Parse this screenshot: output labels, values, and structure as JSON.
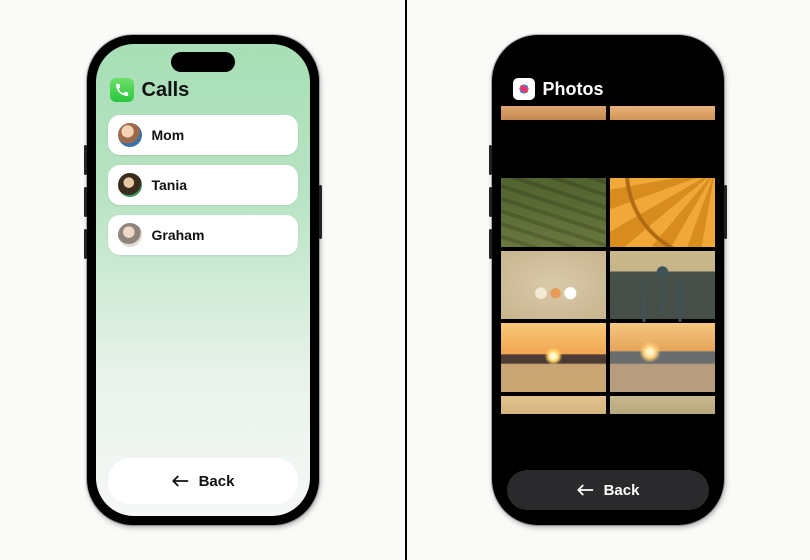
{
  "left": {
    "app_title": "Calls",
    "app_icon": "phone-icon",
    "contacts": [
      {
        "name": "Mom",
        "avatar": "av-mom"
      },
      {
        "name": "Tania",
        "avatar": "av-tania"
      },
      {
        "name": "Graham",
        "avatar": "av-graham"
      }
    ],
    "back_label": "Back"
  },
  "right": {
    "app_title": "Photos",
    "app_icon": "photos-icon",
    "back_label": "Back",
    "thumbnails": [
      "row-top-left",
      "row-top-right",
      "boardwalk-stairs",
      "orange-umbrella",
      "seashells-on-sand",
      "person-shadow-on-sand",
      "ocean-sunset-1",
      "ocean-sunset-2",
      "row-bottom-left",
      "row-bottom-right"
    ]
  }
}
